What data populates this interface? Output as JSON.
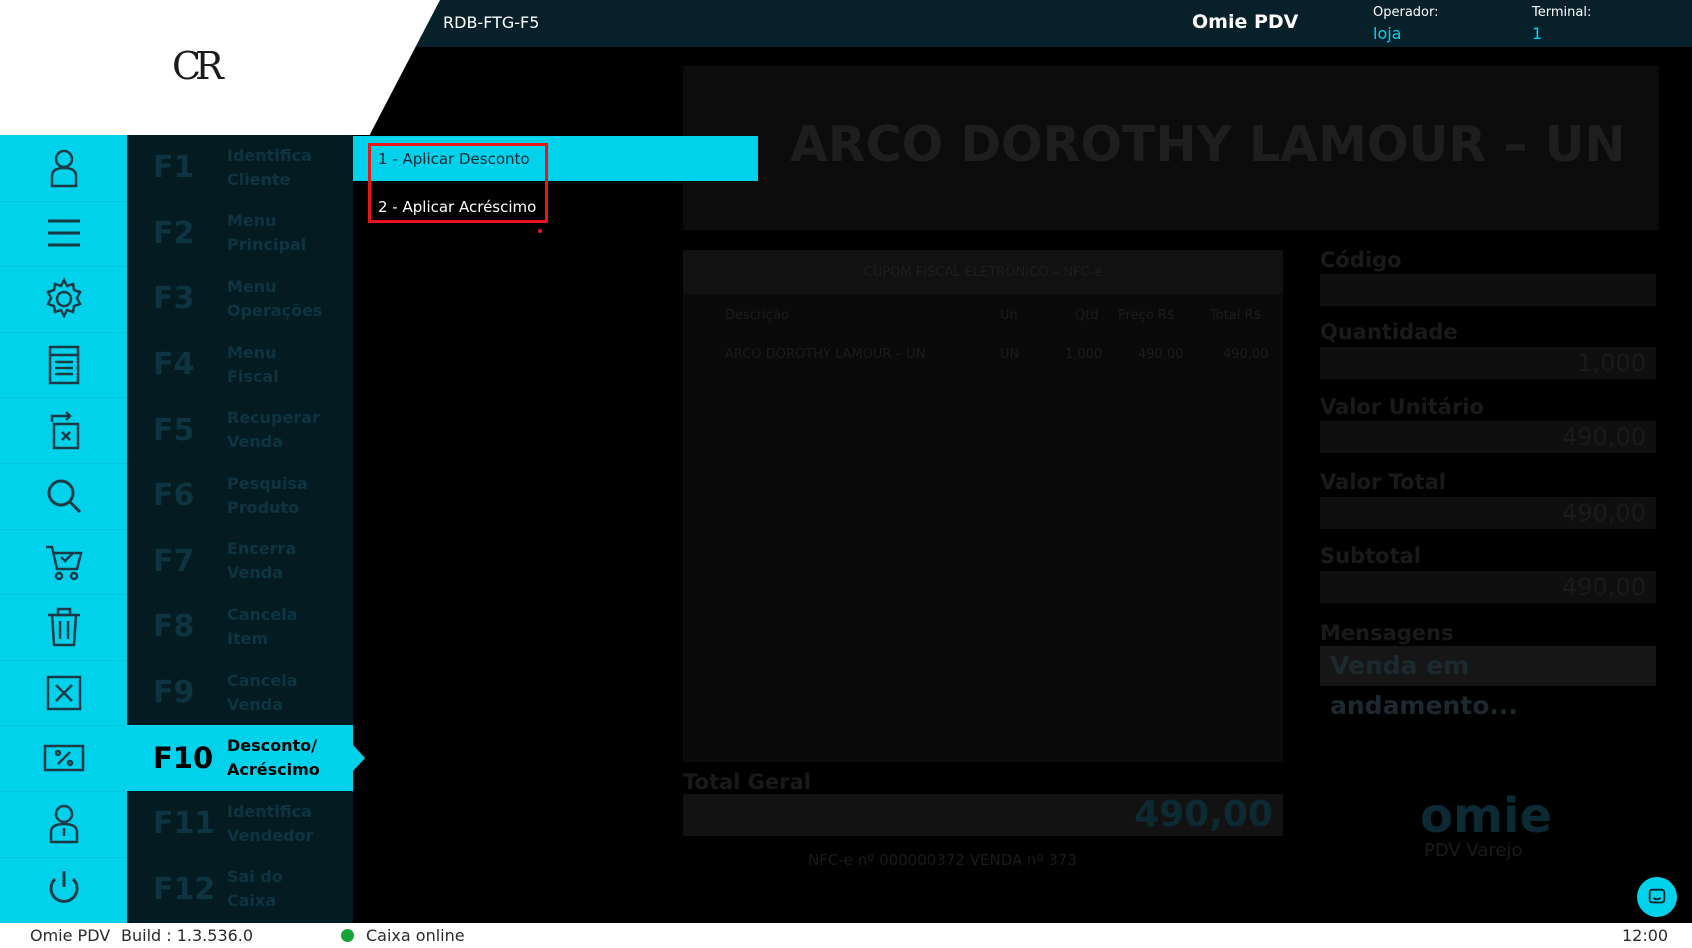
{
  "header": {
    "terminal_code": "RDB-FTG-F5",
    "app_title": "Omie PDV",
    "operator_label": "Operador:",
    "operator_value": "loja",
    "terminal_label": "Terminal:",
    "terminal_value": "1",
    "logo_text": "CR"
  },
  "sidebar": {
    "icons": [
      "user-icon",
      "menu-icon",
      "gear-icon",
      "receipt-icon",
      "recover-sale-icon",
      "search-icon",
      "cart-check-icon",
      "trash-icon",
      "close-box-icon",
      "discount-icon",
      "seller-icon",
      "power-icon"
    ]
  },
  "fkeys": [
    {
      "key": "F1",
      "label": "Identifica\nCliente"
    },
    {
      "key": "F2",
      "label": "Menu\nPrincipal"
    },
    {
      "key": "F3",
      "label": "Menu\nOperações"
    },
    {
      "key": "F4",
      "label": "Menu\nFiscal"
    },
    {
      "key": "F5",
      "label": "Recuperar\nVenda"
    },
    {
      "key": "F6",
      "label": "Pesquisa\nProduto"
    },
    {
      "key": "F7",
      "label": "Encerra\nVenda"
    },
    {
      "key": "F8",
      "label": "Cancela\nItem"
    },
    {
      "key": "F9",
      "label": "Cancela\nVenda"
    },
    {
      "key": "F10",
      "label": "Desconto/\nAcréscimo",
      "active": true
    },
    {
      "key": "F11",
      "label": "Identifica\nVendedor"
    },
    {
      "key": "F12",
      "label": "Sai do\nCaixa"
    }
  ],
  "popup_menu": {
    "item1": "1 - Aplicar Desconto",
    "item2": "2 - Aplicar Acréscimo"
  },
  "main": {
    "product_name": "ARCO DOROTHY LAMOUR – UN",
    "receipt_title": "CUPOM FISCAL ELETRÔNICO – NFC-e",
    "receipt_headers": [
      "Descrição",
      "Un",
      "Qtd",
      "Preço R$",
      "Total R$"
    ],
    "receipt_row": {
      "desc": "ARCO DOROTHY LAMOUR – UN",
      "un": "UN",
      "qtd": "1,000",
      "preco": "490,00",
      "total": "490,00"
    },
    "fields": {
      "codigo_label": "Código",
      "codigo_value": "",
      "quantidade_label": "Quantidade",
      "quantidade_value": "1,000",
      "valor_unitario_label": "Valor Unitário",
      "valor_unitario_value": "490,00",
      "valor_total_label": "Valor Total",
      "valor_total_value": "490,00",
      "subtotal_label": "Subtotal",
      "subtotal_value": "490,00",
      "mensagens_label": "Mensagens",
      "mensagens_value": "Venda em andamento..."
    },
    "total_geral_label": "Total Geral",
    "total_geral_value": "490,00",
    "nfce_info": "NFC-e nº 000000372   VENDA nº 373",
    "brand_logo": "omie",
    "brand_sub": "PDV Varejo"
  },
  "statusbar": {
    "app": "Omie PDV",
    "build": "Build : 1.3.536.0",
    "status": "Caixa online",
    "time": "12:00"
  },
  "colors": {
    "accent": "#00d2ec",
    "topbar": "#072029",
    "highlight": "#e8161b",
    "online": "#1aa33a"
  }
}
